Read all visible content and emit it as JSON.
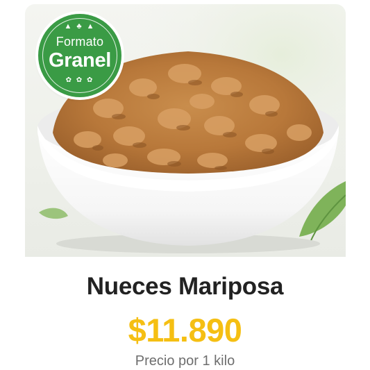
{
  "product": {
    "badge": {
      "top_text": "Formato",
      "main_text": "Granel",
      "color": "#3a9b45",
      "deco_top": "▲ ♣ ▲",
      "deco_bottom": "✿ ✿ ✿"
    },
    "image": {
      "subject": "bowl-of-walnuts-image"
    },
    "name": "Nueces Mariposa",
    "price": "$11.890",
    "price_color": "#f5bf13",
    "price_unit": "Precio por 1 kilo"
  }
}
